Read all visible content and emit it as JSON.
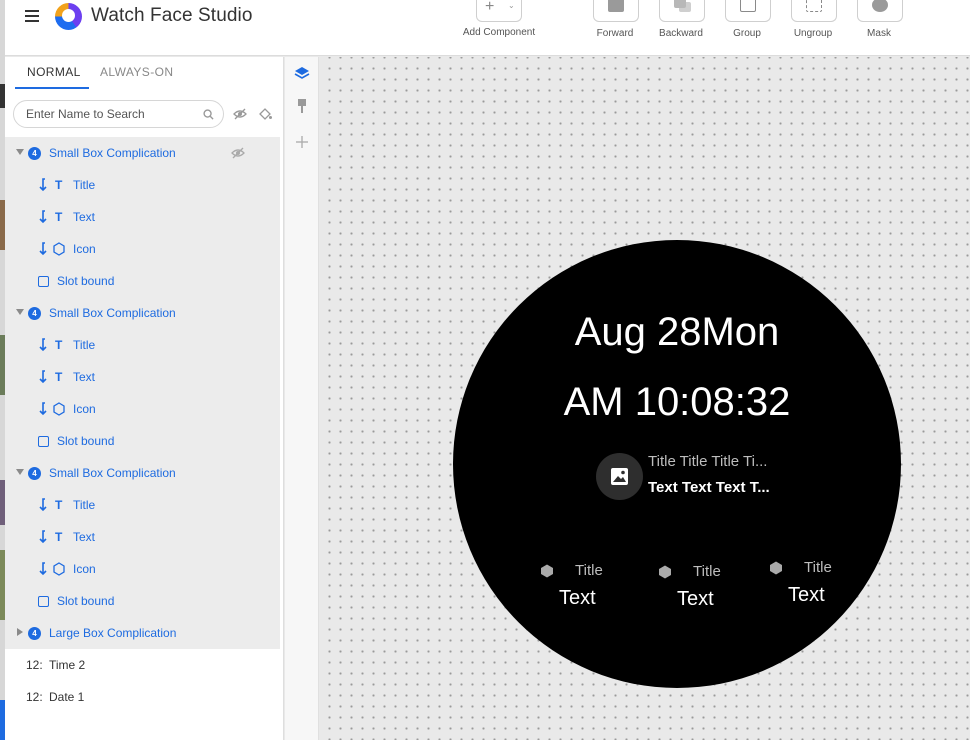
{
  "app": {
    "title": "Watch Face Studio",
    "menu_icon": "hamburger-icon",
    "logo_icon": "watch-face-studio-logo"
  },
  "toolbar": {
    "add_component": "Add Component",
    "forward": "Forward",
    "backward": "Backward",
    "group": "Group",
    "ungroup": "Ungroup",
    "mask": "Mask"
  },
  "panel": {
    "tabs": [
      {
        "label": "NORMAL"
      },
      {
        "label": "ALWAYS-ON"
      }
    ],
    "search_placeholder": "Enter Name to Search",
    "rows": [
      {
        "label": "Small Box Complication",
        "badge": "4"
      },
      {
        "label": "Title"
      },
      {
        "label": "Text"
      },
      {
        "label": "Icon"
      },
      {
        "label": "Slot bound"
      },
      {
        "label": "Small Box Complication",
        "badge": "4"
      },
      {
        "label": "Title"
      },
      {
        "label": "Text"
      },
      {
        "label": "Icon"
      },
      {
        "label": "Slot bound"
      },
      {
        "label": "Small Box Complication",
        "badge": "4"
      },
      {
        "label": "Title"
      },
      {
        "label": "Text"
      },
      {
        "label": "Icon"
      },
      {
        "label": "Slot bound"
      },
      {
        "label": "Large Box Complication",
        "badge": "4"
      },
      {
        "label": "Time 2",
        "prefix": "12:"
      },
      {
        "label": "Date 1",
        "prefix": "12:"
      }
    ],
    "type_glyph": "T"
  },
  "watch": {
    "date": "Aug 28Mon",
    "time": "AM 10:08:32",
    "large": {
      "title": "Title Title Title Ti...",
      "text": "Text Text Text T..."
    },
    "small": [
      {
        "title": "Title",
        "text": "Text"
      },
      {
        "title": "Title",
        "text": "Text"
      },
      {
        "title": "Title",
        "text": "Text"
      }
    ]
  },
  "colors": {
    "accent": "#1e6be0",
    "watch_bg": "#000000",
    "canvas_bg": "#e9e9e9"
  }
}
